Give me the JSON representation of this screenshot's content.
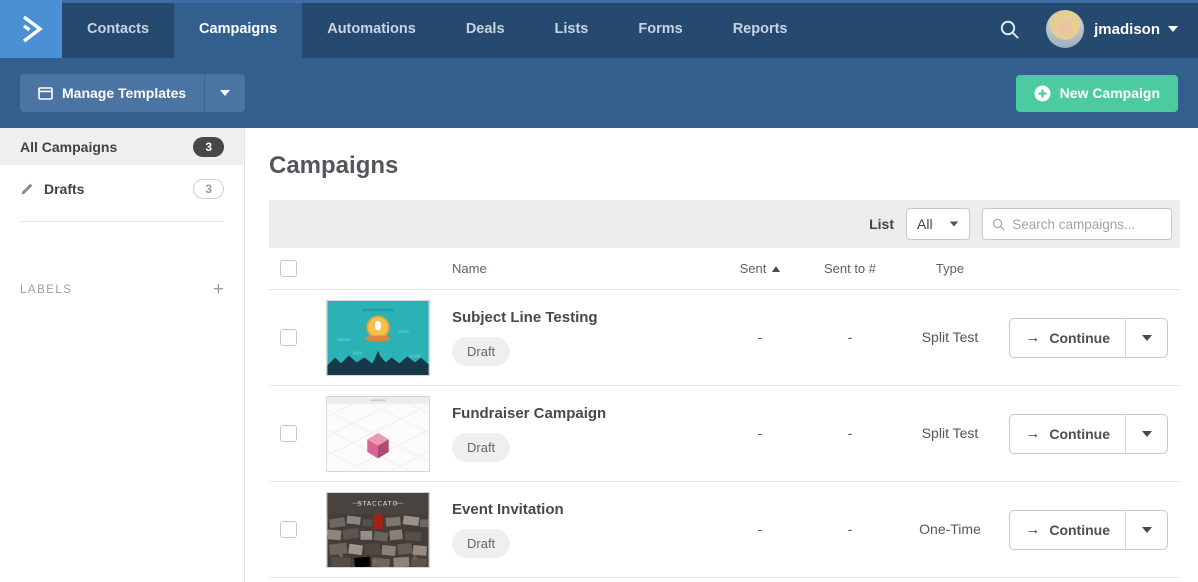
{
  "nav": {
    "items": [
      {
        "label": "Contacts"
      },
      {
        "label": "Campaigns"
      },
      {
        "label": "Automations"
      },
      {
        "label": "Deals"
      },
      {
        "label": "Lists"
      },
      {
        "label": "Forms"
      },
      {
        "label": "Reports"
      }
    ],
    "username": "jmadison"
  },
  "toolbar": {
    "manage_templates_label": "Manage Templates",
    "new_campaign_label": "New Campaign"
  },
  "sidebar": {
    "all_campaigns_label": "All Campaigns",
    "all_campaigns_count": "3",
    "drafts_label": "Drafts",
    "drafts_count": "3",
    "labels_header": "LABELS"
  },
  "main": {
    "title": "Campaigns",
    "filter": {
      "list_label": "List",
      "list_value": "All",
      "search_placeholder": "Search campaigns..."
    },
    "table": {
      "headers": {
        "name": "Name",
        "sent": "Sent",
        "sent_to": "Sent to #",
        "type": "Type"
      },
      "rows": [
        {
          "name": "Subject Line Testing",
          "status": "Draft",
          "sent": "-",
          "sent_to": "-",
          "type": "Split Test",
          "action": "Continue"
        },
        {
          "name": "Fundraiser Campaign",
          "status": "Draft",
          "sent": "-",
          "sent_to": "-",
          "type": "Split Test",
          "action": "Continue"
        },
        {
          "name": "Event Invitation",
          "status": "Draft",
          "sent": "-",
          "sent_to": "-",
          "type": "One-Time",
          "action": "Continue",
          "thumb_text": "STACCATO"
        }
      ]
    }
  },
  "colors": {
    "nav_bg": "#26496f",
    "active_tab": "#335f8e",
    "logo_bg": "#4b8fd5",
    "button_blue": "#4a74a3",
    "accent_green": "#4ccba0",
    "selected_grey": "#efefef",
    "badge_dark": "#484848"
  }
}
